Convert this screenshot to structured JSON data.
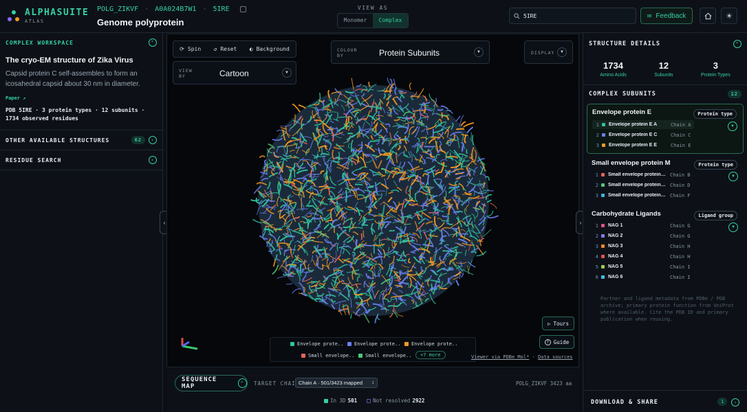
{
  "brand": {
    "name": "ALPHASUITE",
    "sub": "ATLAS"
  },
  "header": {
    "ids": [
      "POLG_ZIKVF",
      "A0A024B7W1",
      "5IRE"
    ],
    "title": "Genome polyprotein",
    "view_as_label": "VIEW AS",
    "view_modes": [
      "Monomer",
      "Complex"
    ],
    "active_view_mode": "Complex",
    "search_value": "5IRE",
    "feedback_label": "Feedback"
  },
  "left": {
    "workspace_heading": "COMPLEX WORKSPACE",
    "title": "The cryo-EM structure of Zika Virus",
    "description": "Capsid protein C self-assembles to form an icosahedral capsid about 30 nm in diameter.",
    "paper_link": "Paper ↗",
    "meta": "PDB 5IRE · 3 protein types · 12 subunits · 1734 observed residues",
    "other_structures": "OTHER AVAILABLE STRUCTURES",
    "other_structures_count": "62",
    "residue_search": "RESIDUE SEARCH"
  },
  "viewer": {
    "tools": [
      "Spin",
      "Reset",
      "Background"
    ],
    "view_by_label": "VIEW BY",
    "view_by_value": "Cartoon",
    "colour_by_label": "COLOUR BY",
    "colour_by_value": "Protein Subunits",
    "display_label": "DISPLAY",
    "legend": [
      {
        "label": "Envelope prote..",
        "color": "#2fc4a0"
      },
      {
        "label": "Envelope prote..",
        "color": "#6a7ff0"
      },
      {
        "label": "Envelope prote..",
        "color": "#f59a23"
      },
      {
        "label": "Small envelope..",
        "color": "#e4665e"
      },
      {
        "label": "Small envelope..",
        "color": "#4cc97a"
      }
    ],
    "legend_more": "+7 more",
    "link_viewer": "Viewer via PDBe Mol*",
    "link_sep": "·",
    "link_data": "Data sources",
    "tours_label": "Tours",
    "guide_label": "Guide"
  },
  "sequence": {
    "title": "SEQUENCE MAP",
    "target_label": "TARGET CHAIN",
    "target_value": "Chain A · 501/3423 mapped",
    "protein_len": "POLG_ZIKVF 3423 aa",
    "in3d_label": "In 3D",
    "in3d_value": "501",
    "notresolved_label": "Not resolved",
    "notresolved_value": "2922"
  },
  "right": {
    "heading": "STRUCTURE DETAILS",
    "stats": [
      {
        "value": "1734",
        "label": "Amino Acids"
      },
      {
        "value": "12",
        "label": "Subunits"
      },
      {
        "value": "3",
        "label": "Protein Types"
      }
    ],
    "subunits_heading": "COMPLEX SUBUNITS",
    "subunits_count": "12",
    "groups": [
      {
        "title": "Envelope protein E",
        "tag": "Protein type",
        "rows": [
          {
            "n": "1",
            "name": "Envelope protein E A",
            "chain": "Chain A",
            "color": "#2fc4a0"
          },
          {
            "n": "2",
            "name": "Envelope protein E C",
            "chain": "Chain C",
            "color": "#6a7ff0"
          },
          {
            "n": "3",
            "name": "Envelope protein E E",
            "chain": "Chain E",
            "color": "#f59a23"
          }
        ]
      },
      {
        "title": "Small envelope protein M",
        "tag": "Protein type",
        "rows": [
          {
            "n": "1",
            "name": "Small envelope protein M B",
            "chain": "Chain B",
            "color": "#e4665e"
          },
          {
            "n": "2",
            "name": "Small envelope protein M D",
            "chain": "Chain D",
            "color": "#4cc97a"
          },
          {
            "n": "3",
            "name": "Small envelope protein M F",
            "chain": "Chain F",
            "color": "#3fb4e6"
          }
        ]
      },
      {
        "title": "Carbohydrate Ligands",
        "tag": "Ligand group",
        "rows": [
          {
            "n": "1",
            "name": "NAG 1",
            "chain": "Chain G",
            "color": "#e4508a"
          },
          {
            "n": "2",
            "name": "NAG 2",
            "chain": "Chain G",
            "color": "#8a7af0"
          },
          {
            "n": "3",
            "name": "NAG 3",
            "chain": "Chain H",
            "color": "#f58a2a"
          },
          {
            "n": "4",
            "name": "NAG 4",
            "chain": "Chain H",
            "color": "#e05555"
          },
          {
            "n": "5",
            "name": "NAG 5",
            "chain": "Chain I",
            "color": "#9ad04a"
          },
          {
            "n": "6",
            "name": "NAG 6",
            "chain": "Chain I",
            "color": "#47b6f0"
          }
        ]
      }
    ],
    "note": "Partner and ligand metadata from PDBe / PDB archive; primary protein function from UniProt where available. Cite the PDB ID and primary publication when reusing.",
    "download_label": "DOWNLOAD & SHARE",
    "download_count": "1"
  },
  "colors": {
    "accent": "#35d0a6",
    "background": "#0b0f14"
  }
}
